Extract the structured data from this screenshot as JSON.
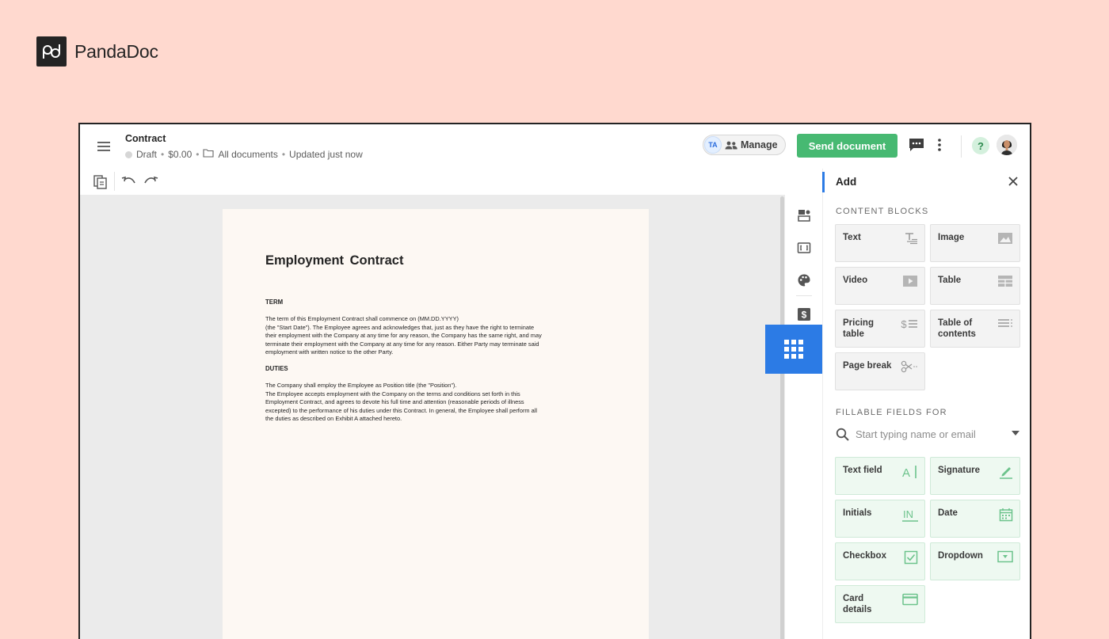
{
  "brand": {
    "name": "PandaDoc"
  },
  "header": {
    "title": "Contract",
    "status": "Draft",
    "amount": "$0.00",
    "folder": "All documents",
    "updated": "Updated just now",
    "separator": "•",
    "manage_initials": "TA",
    "manage_label": "Manage",
    "send_label": "Send document",
    "help_label": "?"
  },
  "document": {
    "title": "Employment  Contract",
    "sections": [
      {
        "heading": "TERM",
        "body": "The term of this Employment Contract shall commence on (MM.DD.YYYY)\n(the \"Start Date\"). The Employee agrees and acknowledges that, just as they have the right to terminate\ntheir employment with the Company at any time for any reason, the Company has the same right, and may\nterminate their employment with the Company at any time for any reason. Either Party may terminate said\nemployment with written notice to the other Party."
      },
      {
        "heading": "DUTIES",
        "body": "The Company shall employ the Employee as Position title (the \"Position\").\nThe Employee accepts employment with the Company on the terms and conditions set forth in this\nEmployment Contract, and agrees to devote his full time and attention (reasonable periods of illness\nexcepted) to the performance of his duties under this Contract. In general, the Employee shall perform all\nthe duties as described on Exhibit A attached hereto."
      }
    ]
  },
  "panel": {
    "title": "Add",
    "content_blocks_heading": "CONTENT BLOCKS",
    "content_blocks": [
      {
        "label": "Text",
        "icon": "text-format-icon"
      },
      {
        "label": "Image",
        "icon": "image-icon"
      },
      {
        "label": "Video",
        "icon": "video-icon"
      },
      {
        "label": "Table",
        "icon": "table-icon"
      },
      {
        "label": "Pricing\ntable",
        "icon": "pricing-table-icon"
      },
      {
        "label": "Table of\ncontents",
        "icon": "toc-icon"
      },
      {
        "label": "Page break",
        "icon": "scissors-icon"
      }
    ],
    "fillable_heading": "FILLABLE FIELDS FOR",
    "search_placeholder": "Start typing name or email",
    "fillable_fields": [
      {
        "label": "Text field",
        "icon": "text-cursor-icon"
      },
      {
        "label": "Signature",
        "icon": "pen-icon"
      },
      {
        "label": "Initials",
        "icon": "initials-icon"
      },
      {
        "label": "Date",
        "icon": "calendar-icon"
      },
      {
        "label": "Checkbox",
        "icon": "checkbox-icon"
      },
      {
        "label": "Dropdown",
        "icon": "dropdown-icon"
      },
      {
        "label": "Card\ndetails",
        "icon": "credit-card-icon"
      }
    ]
  },
  "rail": {
    "items": [
      "blocks-icon",
      "variables-icon",
      "palette-icon",
      "dollar-icon",
      "grid-apps-icon"
    ]
  },
  "colors": {
    "background": "#ffd9cf",
    "send_button": "#47b972",
    "accent_blue": "#2c7be5",
    "fillable_tile": "#eef9f1",
    "page": "#fdf8f3"
  }
}
